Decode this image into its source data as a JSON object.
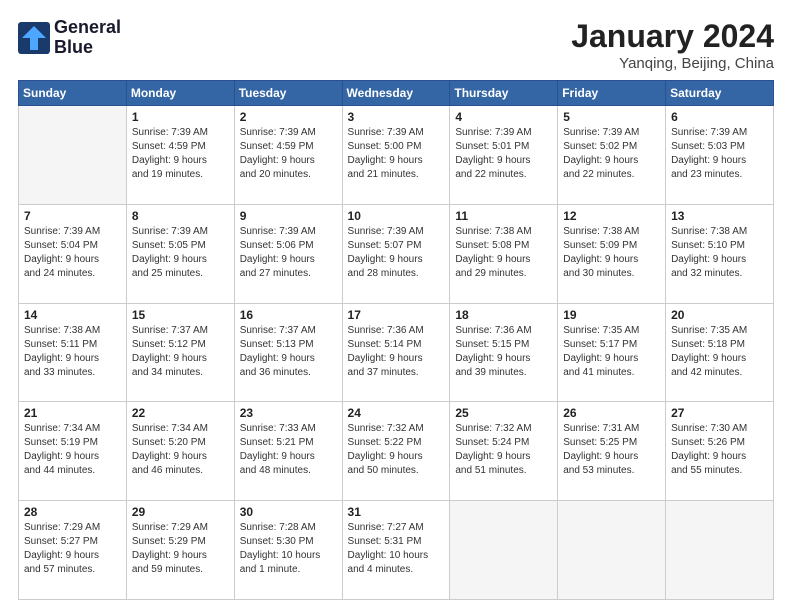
{
  "header": {
    "logo_line1": "General",
    "logo_line2": "Blue",
    "month_title": "January 2024",
    "location": "Yanqing, Beijing, China"
  },
  "weekdays": [
    "Sunday",
    "Monday",
    "Tuesday",
    "Wednesday",
    "Thursday",
    "Friday",
    "Saturday"
  ],
  "weeks": [
    [
      {
        "day": "",
        "info": ""
      },
      {
        "day": "1",
        "info": "Sunrise: 7:39 AM\nSunset: 4:59 PM\nDaylight: 9 hours\nand 19 minutes."
      },
      {
        "day": "2",
        "info": "Sunrise: 7:39 AM\nSunset: 4:59 PM\nDaylight: 9 hours\nand 20 minutes."
      },
      {
        "day": "3",
        "info": "Sunrise: 7:39 AM\nSunset: 5:00 PM\nDaylight: 9 hours\nand 21 minutes."
      },
      {
        "day": "4",
        "info": "Sunrise: 7:39 AM\nSunset: 5:01 PM\nDaylight: 9 hours\nand 22 minutes."
      },
      {
        "day": "5",
        "info": "Sunrise: 7:39 AM\nSunset: 5:02 PM\nDaylight: 9 hours\nand 22 minutes."
      },
      {
        "day": "6",
        "info": "Sunrise: 7:39 AM\nSunset: 5:03 PM\nDaylight: 9 hours\nand 23 minutes."
      }
    ],
    [
      {
        "day": "7",
        "info": "Sunrise: 7:39 AM\nSunset: 5:04 PM\nDaylight: 9 hours\nand 24 minutes."
      },
      {
        "day": "8",
        "info": "Sunrise: 7:39 AM\nSunset: 5:05 PM\nDaylight: 9 hours\nand 25 minutes."
      },
      {
        "day": "9",
        "info": "Sunrise: 7:39 AM\nSunset: 5:06 PM\nDaylight: 9 hours\nand 27 minutes."
      },
      {
        "day": "10",
        "info": "Sunrise: 7:39 AM\nSunset: 5:07 PM\nDaylight: 9 hours\nand 28 minutes."
      },
      {
        "day": "11",
        "info": "Sunrise: 7:38 AM\nSunset: 5:08 PM\nDaylight: 9 hours\nand 29 minutes."
      },
      {
        "day": "12",
        "info": "Sunrise: 7:38 AM\nSunset: 5:09 PM\nDaylight: 9 hours\nand 30 minutes."
      },
      {
        "day": "13",
        "info": "Sunrise: 7:38 AM\nSunset: 5:10 PM\nDaylight: 9 hours\nand 32 minutes."
      }
    ],
    [
      {
        "day": "14",
        "info": "Sunrise: 7:38 AM\nSunset: 5:11 PM\nDaylight: 9 hours\nand 33 minutes."
      },
      {
        "day": "15",
        "info": "Sunrise: 7:37 AM\nSunset: 5:12 PM\nDaylight: 9 hours\nand 34 minutes."
      },
      {
        "day": "16",
        "info": "Sunrise: 7:37 AM\nSunset: 5:13 PM\nDaylight: 9 hours\nand 36 minutes."
      },
      {
        "day": "17",
        "info": "Sunrise: 7:36 AM\nSunset: 5:14 PM\nDaylight: 9 hours\nand 37 minutes."
      },
      {
        "day": "18",
        "info": "Sunrise: 7:36 AM\nSunset: 5:15 PM\nDaylight: 9 hours\nand 39 minutes."
      },
      {
        "day": "19",
        "info": "Sunrise: 7:35 AM\nSunset: 5:17 PM\nDaylight: 9 hours\nand 41 minutes."
      },
      {
        "day": "20",
        "info": "Sunrise: 7:35 AM\nSunset: 5:18 PM\nDaylight: 9 hours\nand 42 minutes."
      }
    ],
    [
      {
        "day": "21",
        "info": "Sunrise: 7:34 AM\nSunset: 5:19 PM\nDaylight: 9 hours\nand 44 minutes."
      },
      {
        "day": "22",
        "info": "Sunrise: 7:34 AM\nSunset: 5:20 PM\nDaylight: 9 hours\nand 46 minutes."
      },
      {
        "day": "23",
        "info": "Sunrise: 7:33 AM\nSunset: 5:21 PM\nDaylight: 9 hours\nand 48 minutes."
      },
      {
        "day": "24",
        "info": "Sunrise: 7:32 AM\nSunset: 5:22 PM\nDaylight: 9 hours\nand 50 minutes."
      },
      {
        "day": "25",
        "info": "Sunrise: 7:32 AM\nSunset: 5:24 PM\nDaylight: 9 hours\nand 51 minutes."
      },
      {
        "day": "26",
        "info": "Sunrise: 7:31 AM\nSunset: 5:25 PM\nDaylight: 9 hours\nand 53 minutes."
      },
      {
        "day": "27",
        "info": "Sunrise: 7:30 AM\nSunset: 5:26 PM\nDaylight: 9 hours\nand 55 minutes."
      }
    ],
    [
      {
        "day": "28",
        "info": "Sunrise: 7:29 AM\nSunset: 5:27 PM\nDaylight: 9 hours\nand 57 minutes."
      },
      {
        "day": "29",
        "info": "Sunrise: 7:29 AM\nSunset: 5:29 PM\nDaylight: 9 hours\nand 59 minutes."
      },
      {
        "day": "30",
        "info": "Sunrise: 7:28 AM\nSunset: 5:30 PM\nDaylight: 10 hours\nand 1 minute."
      },
      {
        "day": "31",
        "info": "Sunrise: 7:27 AM\nSunset: 5:31 PM\nDaylight: 10 hours\nand 4 minutes."
      },
      {
        "day": "",
        "info": ""
      },
      {
        "day": "",
        "info": ""
      },
      {
        "day": "",
        "info": ""
      }
    ]
  ]
}
